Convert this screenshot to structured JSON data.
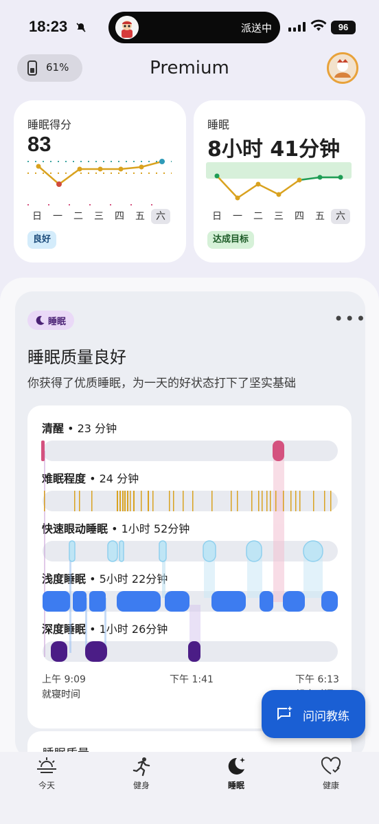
{
  "status_bar": {
    "time": "18:23",
    "island_text": "派送中",
    "battery": "96"
  },
  "header": {
    "battery_pill": "61%",
    "title": "Premium"
  },
  "cards": {
    "sleep_score": {
      "label": "睡眠得分",
      "value": "83",
      "days": [
        "日",
        "一",
        "二",
        "三",
        "四",
        "五",
        "六"
      ],
      "active_day": "六",
      "chip": "良好",
      "chart_data": {
        "type": "line",
        "categories": [
          "日",
          "一",
          "二",
          "三",
          "四",
          "五",
          "六"
        ],
        "values": [
          80,
          74,
          78,
          78,
          78,
          79,
          83
        ]
      }
    },
    "sleep_duration": {
      "label": "睡眠",
      "value": "8小时 41分钟",
      "days": [
        "日",
        "一",
        "二",
        "三",
        "四",
        "五",
        "六"
      ],
      "active_day": "六",
      "chip": "达成目标"
    }
  },
  "panel": {
    "tag": "睡眠",
    "title": "睡眠质量良好",
    "subtitle": "你获得了优质睡眠，为一天的好状态打下了坚实基础",
    "stages": [
      {
        "name": "清醒",
        "value": " • 23 分钟"
      },
      {
        "name": "难眠程度",
        "value": " • 24 分钟"
      },
      {
        "name": "快速眼动睡眠",
        "value": " • 1小时 52分钟"
      },
      {
        "name": "浅度睡眠",
        "value": " • 5小时 22分钟"
      },
      {
        "name": "深度睡眠",
        "value": " • 1小时 26分钟"
      }
    ],
    "times": {
      "start": "上午 9:09",
      "mid": "下午 1:41",
      "end": "下午 6:13"
    },
    "start_label": "就寝时间",
    "end_label": "起床时间",
    "section2": "睡眠质量"
  },
  "fab": {
    "label": "问问教练"
  },
  "nav": [
    {
      "label": "今天",
      "icon": "sunrise-icon"
    },
    {
      "label": "健身",
      "icon": "running-icon"
    },
    {
      "label": "睡眠",
      "icon": "moon-icon"
    },
    {
      "label": "健康",
      "icon": "heart-check-icon"
    }
  ],
  "colors": {
    "awake": "#d4527f",
    "restless": "#d9a21f",
    "rem": "#a9dcf2",
    "light": "#3d7cf0",
    "deep": "#4b1d86",
    "track": "#e8eaf0",
    "fab": "#1a5fd4",
    "score_line": "#d9a21f"
  }
}
